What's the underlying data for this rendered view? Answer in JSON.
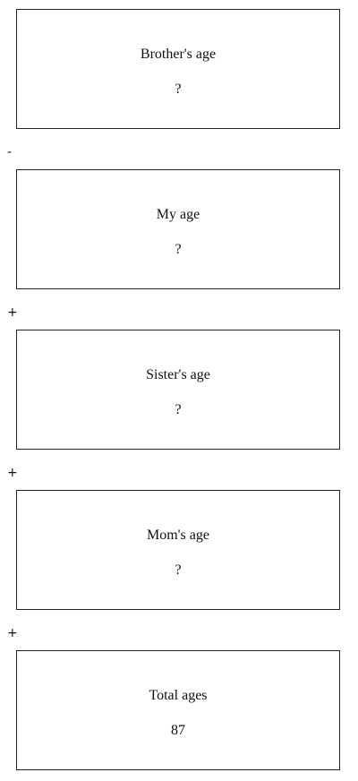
{
  "cards": [
    {
      "title": "Brother's age",
      "value": "?"
    },
    {
      "title": "My age",
      "value": "?"
    },
    {
      "title": "Sister's age",
      "value": "?"
    },
    {
      "title": "Mom's age",
      "value": "?"
    },
    {
      "title": "Total ages",
      "value": "87"
    }
  ],
  "operators": [
    "-",
    "+",
    "+",
    "+"
  ]
}
